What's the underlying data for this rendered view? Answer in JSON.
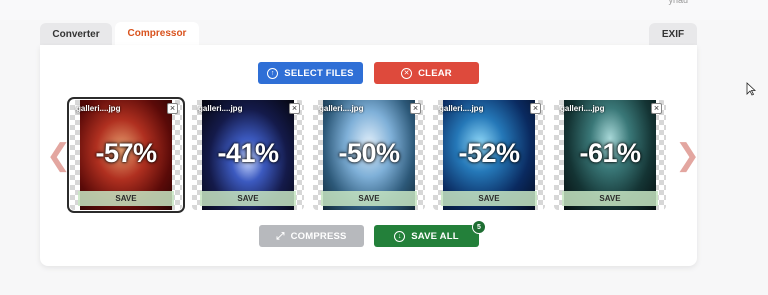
{
  "header": {
    "corner_text": "ynau"
  },
  "tabs": {
    "converter": "Converter",
    "compressor": "Compressor",
    "exif": "EXIF"
  },
  "toolbar": {
    "select_files": "SELECT FILES",
    "clear": "CLEAR",
    "compress": "COMPRESS",
    "save_all": "SAVE ALL",
    "save_all_count": "5"
  },
  "icons": {
    "select_files": "upload-circle-icon",
    "clear": "x-circle-icon",
    "compress": "compress-arrows-icon",
    "save_all": "download-circle-icon"
  },
  "colors": {
    "accent_tab": "#d9531e",
    "select_files": "#2f6fd6",
    "clear": "#de4a3c",
    "compress_disabled": "#b7b9bd",
    "save_all": "#23803a"
  },
  "images": [
    {
      "name": "galleri....jpg",
      "reduction": "-57%",
      "save": "SAVE",
      "selected": true
    },
    {
      "name": "galleri....jpg",
      "reduction": "-41%",
      "save": "SAVE",
      "selected": false
    },
    {
      "name": "galleri....jpg",
      "reduction": "-50%",
      "save": "SAVE",
      "selected": false
    },
    {
      "name": "galleri....jpg",
      "reduction": "-52%",
      "save": "SAVE",
      "selected": false
    },
    {
      "name": "galleri....jpg",
      "reduction": "-61%",
      "save": "SAVE",
      "selected": false
    }
  ]
}
